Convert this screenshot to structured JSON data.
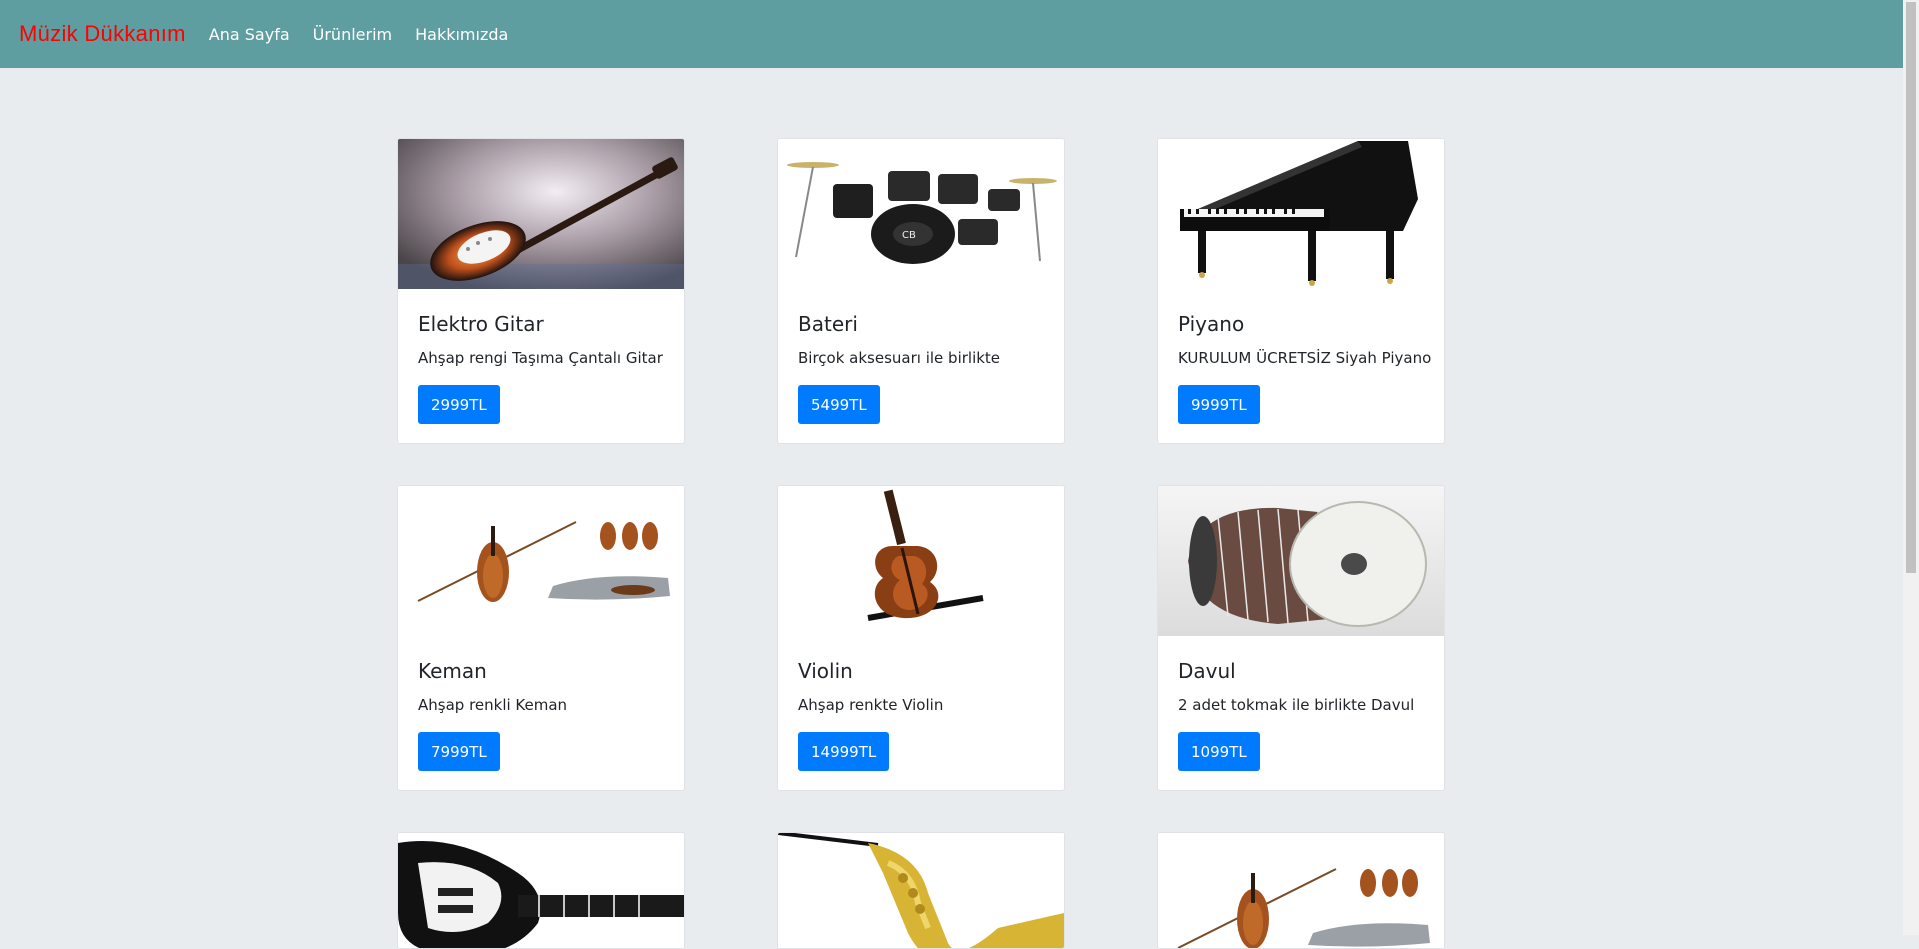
{
  "nav": {
    "brand": "Müzik Dükkanım",
    "links": [
      "Ana Sayfa",
      "Ürünlerim",
      "Hakkımızda"
    ]
  },
  "products": [
    {
      "title": "Elektro Gitar",
      "description": "Ahşap rengi Taşıma Çantalı Gitar",
      "price": "2999TL",
      "image": "electric-guitar"
    },
    {
      "title": "Bateri",
      "description": "Birçok aksesuarı ile birlikte",
      "price": "5499TL",
      "image": "drum-kit"
    },
    {
      "title": "Piyano",
      "description": "KURULUM ÜCRETSİZ Siyah Piyano",
      "price": "9999TL",
      "image": "grand-piano"
    },
    {
      "title": "Keman",
      "description": "Ahşap renkli Keman",
      "price": "7999TL",
      "image": "violin-set"
    },
    {
      "title": "Violin",
      "description": "Ahşap renkte Violin",
      "price": "14999TL",
      "image": "violin"
    },
    {
      "title": "Davul",
      "description": "2 adet tokmak ile birlikte Davul",
      "price": "1099TL",
      "image": "davul-drum"
    }
  ],
  "partial_products": [
    {
      "image": "black-electric-guitar"
    },
    {
      "image": "saxophone"
    },
    {
      "image": "violin-set"
    }
  ],
  "colors": {
    "navbar": "#5f9ea0",
    "brand": "#ff0000",
    "button": "#007bff",
    "background": "#e9ecef"
  }
}
